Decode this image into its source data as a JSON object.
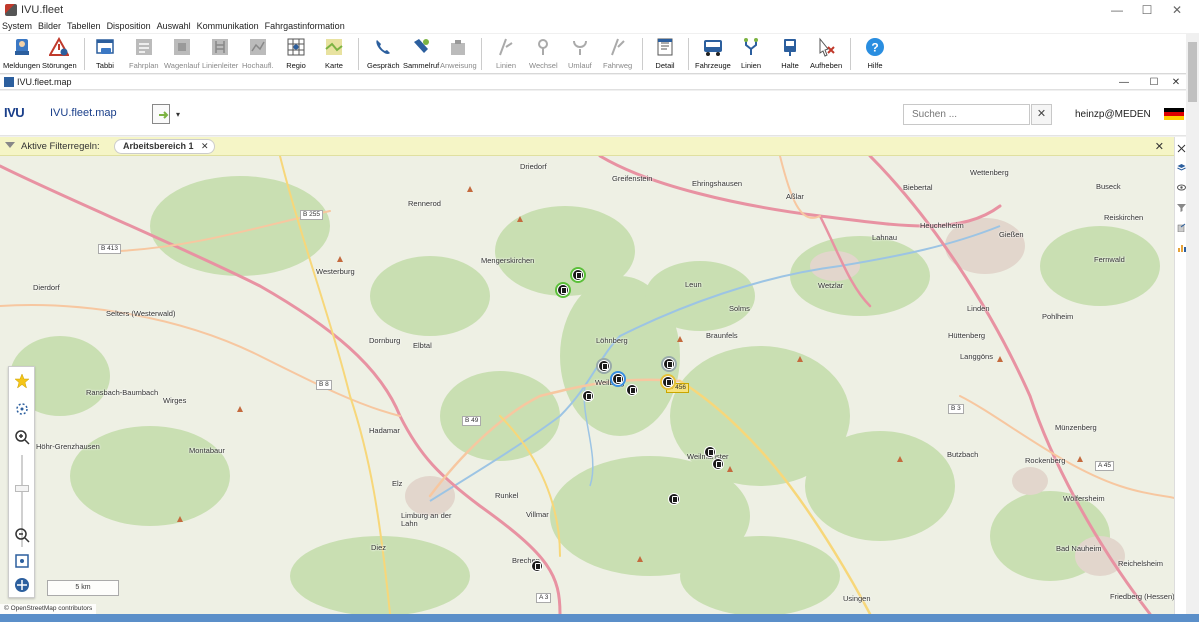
{
  "window": {
    "title": "IVU.fleet",
    "minimize": "—",
    "maximize": "☐",
    "close": "✕"
  },
  "menu": [
    "System",
    "Bilder",
    "Tabellen",
    "Disposition",
    "Auswahl",
    "Kommunikation",
    "Fahrgastinformation"
  ],
  "toolbar": {
    "buttons": [
      {
        "label": "Meldungen",
        "icon": "messages-icon",
        "enabled": true
      },
      {
        "label": "Störungen",
        "icon": "warning-icon",
        "enabled": true
      },
      {
        "label": "Tabbi",
        "icon": "tabbi-icon",
        "enabled": true
      },
      {
        "label": "Fahrplan",
        "icon": "timetable-icon",
        "enabled": false
      },
      {
        "label": "Wagenlauf",
        "icon": "vehicle-run-icon",
        "enabled": false
      },
      {
        "label": "Linienleiter",
        "icon": "line-ladder-icon",
        "enabled": false
      },
      {
        "label": "Hochaufl.",
        "icon": "high-res-icon",
        "enabled": false
      },
      {
        "label": "Regio",
        "icon": "regio-icon",
        "enabled": true
      },
      {
        "label": "Karte",
        "icon": "map-icon",
        "enabled": true
      },
      {
        "label": "Gespräch",
        "icon": "phone-icon",
        "enabled": true
      },
      {
        "label": "Sammelruf",
        "icon": "group-call-icon",
        "enabled": true
      },
      {
        "label": "Anweisung",
        "icon": "instruction-icon",
        "enabled": false
      },
      {
        "label": "Linien",
        "icon": "lines-icon",
        "enabled": false
      },
      {
        "label": "Wechsel",
        "icon": "switch-icon",
        "enabled": false
      },
      {
        "label": "Umlauf",
        "icon": "circulation-icon",
        "enabled": false
      },
      {
        "label": "Fahrweg",
        "icon": "route-icon",
        "enabled": false
      },
      {
        "label": "Detail",
        "icon": "detail-icon",
        "enabled": true
      },
      {
        "label": "Fahrzeuge",
        "icon": "bus-icon",
        "enabled": true
      },
      {
        "label": "Linien",
        "icon": "line-branch-icon",
        "enabled": true
      },
      {
        "label": "Halte",
        "icon": "stop-icon",
        "enabled": true
      },
      {
        "label": "Aufheben",
        "icon": "cancel-selection-icon",
        "enabled": true
      },
      {
        "label": "Hilfe",
        "icon": "help-icon",
        "enabled": true
      }
    ]
  },
  "mapwindow": {
    "title": "IVU.fleet.map"
  },
  "header": {
    "logo": "IVU",
    "product": "IVU.fleet.map",
    "search_placeholder": "Suchen ...",
    "clear": "✕",
    "user": "heinzp@MEDEN",
    "dropdown": "▾"
  },
  "filter": {
    "label": "Aktive Filterregeln:",
    "chip": "Arbeitsbereich 1",
    "chip_close": "✕",
    "close": "✕"
  },
  "map": {
    "places": [
      {
        "name": "Driedorf"
      },
      {
        "name": "Greifenstein"
      },
      {
        "name": "Ehringshausen"
      },
      {
        "name": "Aßlar"
      },
      {
        "name": "Biebertal"
      },
      {
        "name": "Wettenberg"
      },
      {
        "name": "Buseck"
      },
      {
        "name": "Rennerod"
      },
      {
        "name": "Heuchelheim"
      },
      {
        "name": "Gießen"
      },
      {
        "name": "Reiskirchen"
      },
      {
        "name": "Lahnau"
      },
      {
        "name": "Mengerskirchen"
      },
      {
        "name": "Leun"
      },
      {
        "name": "Wetzlar"
      },
      {
        "name": "Fernwald"
      },
      {
        "name": "Westerburg"
      },
      {
        "name": "Dierdorf"
      },
      {
        "name": "Solms"
      },
      {
        "name": "Selters (Westerwald)"
      },
      {
        "name": "Löhnberg"
      },
      {
        "name": "Linden"
      },
      {
        "name": "Pohlheim"
      },
      {
        "name": "Braunfels"
      },
      {
        "name": "Dornburg"
      },
      {
        "name": "Elbtal"
      },
      {
        "name": "Hüttenberg"
      },
      {
        "name": "Langgöns"
      },
      {
        "name": "Weilburg"
      },
      {
        "name": "Ransbach-Baumbach"
      },
      {
        "name": "Wirges"
      },
      {
        "name": "Hadamar"
      },
      {
        "name": "Höhr-Grenzhausen"
      },
      {
        "name": "Münzenberg"
      },
      {
        "name": "Weilmünster"
      },
      {
        "name": "Montabaur"
      },
      {
        "name": "Butzbach"
      },
      {
        "name": "Rockenberg"
      },
      {
        "name": "Elz"
      },
      {
        "name": "Runkel"
      },
      {
        "name": "Limburg an der Lahn"
      },
      {
        "name": "Wölfersheim"
      },
      {
        "name": "Villmar"
      },
      {
        "name": "Diez"
      },
      {
        "name": "Bad Nauheim"
      },
      {
        "name": "Brechen"
      },
      {
        "name": "Reichelsheim"
      },
      {
        "name": "Usingen"
      },
      {
        "name": "Friedberg (Hessen)"
      }
    ],
    "roads": [
      {
        "name": "B 255",
        "type": "white"
      },
      {
        "name": "B 413",
        "type": "white"
      },
      {
        "name": "B 8",
        "type": "white"
      },
      {
        "name": "B 49",
        "type": "white"
      },
      {
        "name": "B 456",
        "type": "yellow"
      },
      {
        "name": "B 3",
        "type": "white"
      },
      {
        "name": "A 45",
        "type": "white"
      },
      {
        "name": "A 3",
        "type": "white"
      }
    ],
    "vehicles": [
      {
        "status": "green"
      },
      {
        "status": "green"
      },
      {
        "status": "normal"
      },
      {
        "status": "blue"
      },
      {
        "status": "normal"
      },
      {
        "status": "normal"
      },
      {
        "status": "normal"
      },
      {
        "status": "yellow"
      },
      {
        "status": "normal"
      },
      {
        "status": "normal"
      },
      {
        "status": "normal"
      },
      {
        "status": "normal"
      }
    ],
    "scale": "5 km",
    "attribution": "© OpenStreetMap contributors"
  },
  "colors": {
    "accent": "#1a3f8a",
    "filter_bg": "#f5f5c6",
    "map_bg": "#eef0e4",
    "forest": "#c9dfb2",
    "motorway": "#e892a2",
    "trunk": "#f7c7a0"
  }
}
